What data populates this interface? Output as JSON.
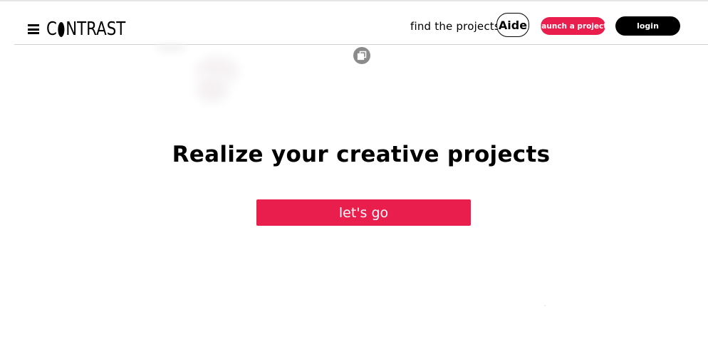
{
  "header": {
    "logo_text_left": "C",
    "logo_text_right": "NTRAST",
    "find_projects_label": "find the projects",
    "aide_label": "Aide",
    "launch_label": "launch a project",
    "login_label": "login"
  },
  "hero": {
    "title": "Realize your creative projects",
    "cta_label": "let's go"
  },
  "colors": {
    "accent": "#e91e4c",
    "dark_button": "#000000",
    "floating_icon": "#8b8b8b"
  },
  "icons": {
    "menu": "hamburger-menu-icon",
    "floating": "stacked-squares-icon"
  }
}
